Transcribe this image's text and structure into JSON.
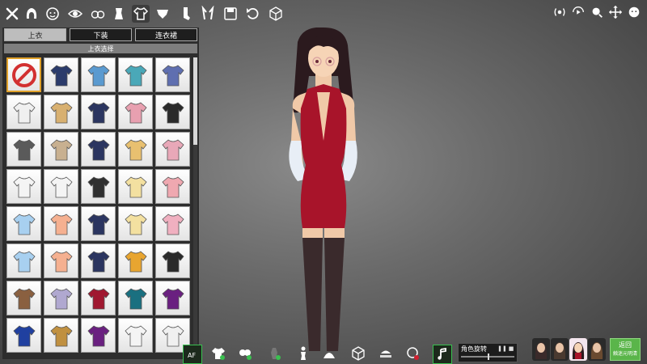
{
  "window": {
    "close_label": "✕"
  },
  "top_toolbar": {
    "icons": [
      "close-icon",
      "hair-icon",
      "face-icon",
      "eye-icon",
      "chest-icon",
      "body-icon",
      "top-clothing-icon",
      "underwear-icon",
      "sock-icon",
      "bunny-ears-icon",
      "save-icon",
      "undo-icon",
      "cube-icon"
    ],
    "active_index": 6
  },
  "right_icons": [
    "sound-waves-icon",
    "camera-move-icon",
    "zoom-icon",
    "move-icon",
    "face-preset-icon"
  ],
  "panel": {
    "tabs": [
      {
        "label": "上衣",
        "selected": true
      },
      {
        "label": "下装",
        "selected": false
      },
      {
        "label": "连衣裙",
        "selected": false
      }
    ],
    "subheading": "上衣选择",
    "items": [
      {
        "name": "none",
        "color": "#d23030"
      },
      {
        "name": "sailor-navy",
        "color": "#2b3b6b"
      },
      {
        "name": "sailor-blue",
        "color": "#5a9ad0"
      },
      {
        "name": "sailor-teal",
        "color": "#4aa8b8"
      },
      {
        "name": "sailor-red-tie",
        "color": "#5f6fb0"
      },
      {
        "name": "shirt-white",
        "color": "#f0f0f0"
      },
      {
        "name": "vest-tan",
        "color": "#d8b070"
      },
      {
        "name": "shirt-navy-vest",
        "color": "#2b3560"
      },
      {
        "name": "shirt-pink",
        "color": "#e8a0b0"
      },
      {
        "name": "blazer-black",
        "color": "#2a2a2a"
      },
      {
        "name": "blazer-grey",
        "color": "#5a5a5a"
      },
      {
        "name": "blazer-tan",
        "color": "#c8b090"
      },
      {
        "name": "open-jacket-navy",
        "color": "#2b3560"
      },
      {
        "name": "open-jacket-yellow",
        "color": "#e8c070"
      },
      {
        "name": "open-jacket-pink",
        "color": "#e8a8b8"
      },
      {
        "name": "tee-white",
        "color": "#f4f4f4"
      },
      {
        "name": "tee-white-2",
        "color": "#f4f4f4"
      },
      {
        "name": "tee-black",
        "color": "#303030"
      },
      {
        "name": "tee-cream",
        "color": "#f3e0a0"
      },
      {
        "name": "tee-pink",
        "color": "#efa8b0"
      },
      {
        "name": "tunic-lightblue",
        "color": "#a8d0f0"
      },
      {
        "name": "tunic-peach",
        "color": "#f5b090"
      },
      {
        "name": "tunic-navy",
        "color": "#2b3560"
      },
      {
        "name": "tunic-cream",
        "color": "#f3e0a0"
      },
      {
        "name": "tunic-pink",
        "color": "#f0b0c0"
      },
      {
        "name": "blouse-lightblue",
        "color": "#a8d0f0"
      },
      {
        "name": "blouse-peach",
        "color": "#f5b090"
      },
      {
        "name": "blouse-navy",
        "color": "#2b3560"
      },
      {
        "name": "tank-mustard",
        "color": "#e8a530"
      },
      {
        "name": "tank-black",
        "color": "#2a2a2a"
      },
      {
        "name": "sweater-brown",
        "color": "#8a6040"
      },
      {
        "name": "sweater-lavender",
        "color": "#b0a8d0"
      },
      {
        "name": "sweater-crimson",
        "color": "#a01830"
      },
      {
        "name": "sweater-teal",
        "color": "#1a7080"
      },
      {
        "name": "halter-purple",
        "color": "#6a2080"
      },
      {
        "name": "halter-blue",
        "color": "#2040a0"
      },
      {
        "name": "halter-leopard",
        "color": "#c09040"
      },
      {
        "name": "halter-purple-2",
        "color": "#6a2080"
      },
      {
        "name": "tee-white-3",
        "color": "#f4f4f4"
      },
      {
        "name": "tee-white-red",
        "color": "#f0f0f0"
      }
    ]
  },
  "bottom_toolbar": {
    "icons": [
      "auto-focus-icon",
      "clothing-toggle-icon",
      "underwear-toggle-icon",
      "body-toggle-icon",
      "figure-icon",
      "light-icon",
      "cube-icon",
      "stage-icon",
      "balloon-icon",
      "music-icon"
    ]
  },
  "rotation": {
    "label": "角色旋转",
    "pause": "❚❚",
    "stop": "■"
  },
  "presets": [
    "character-preset-1",
    "character-preset-2",
    "character-preset-3",
    "character-preset-4"
  ],
  "return_button": {
    "line1": "返回",
    "line2": "触迷元明清"
  }
}
